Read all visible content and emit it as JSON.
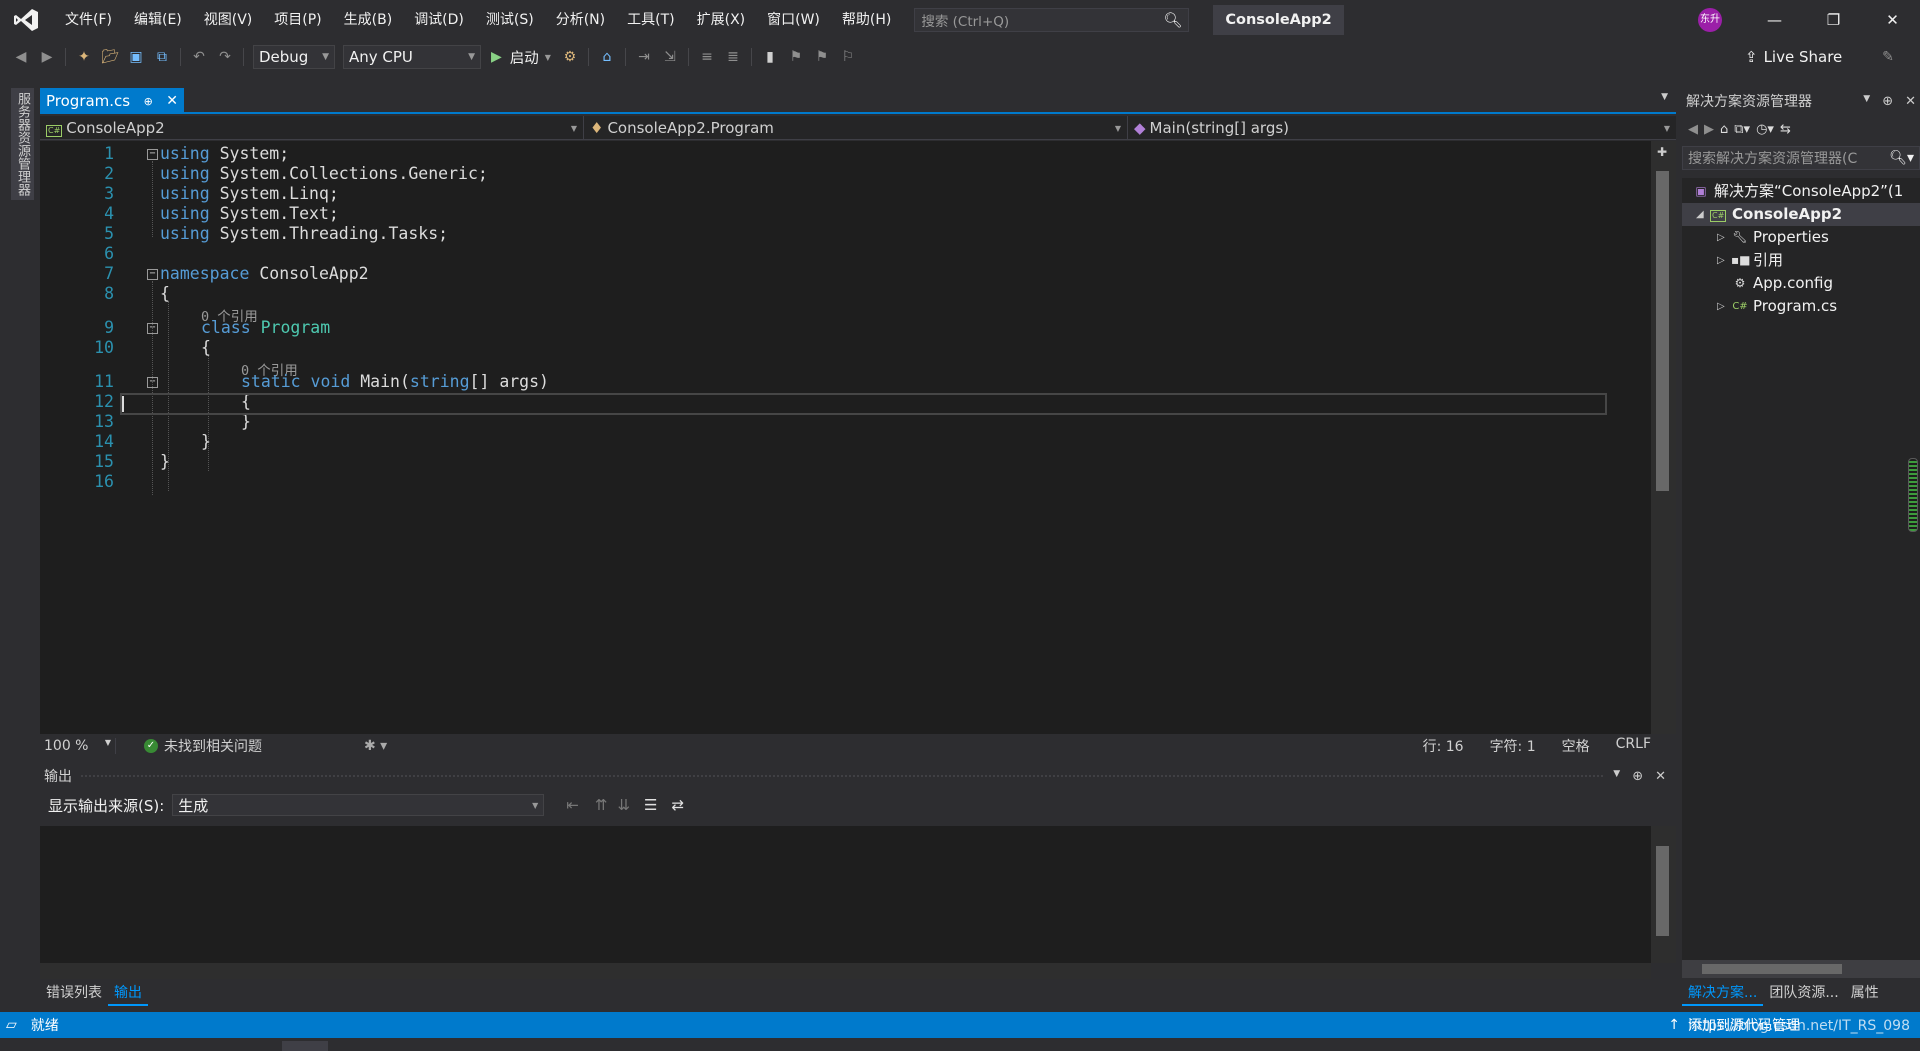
{
  "menu": [
    "文件(F)",
    "编辑(E)",
    "视图(V)",
    "项目(P)",
    "生成(B)",
    "调试(D)",
    "测试(S)",
    "分析(N)",
    "工具(T)",
    "扩展(X)",
    "窗口(W)",
    "帮助(H)"
  ],
  "search": {
    "placeholder": "搜索 (Ctrl+Q)"
  },
  "title": "ConsoleApp2",
  "avatar": "东升",
  "toolbar": {
    "config": "Debug",
    "platform": "Any CPU",
    "run_label": "启动",
    "live_share": "Live Share"
  },
  "server_explorer": "服务器资源管理器",
  "editor": {
    "tab": "Program.cs",
    "nav_project": "ConsoleApp2",
    "nav_class": "ConsoleApp2.Program",
    "nav_member": "Main(string[] args)",
    "code_lens": "0 个引用",
    "line_numbers": [
      "1",
      "2",
      "3",
      "4",
      "5",
      "6",
      "7",
      "8",
      "9",
      "10",
      "11",
      "12",
      "13",
      "14",
      "15",
      "16"
    ],
    "code": {
      "l1_kw": "using",
      "l1_rest": " System;",
      "l2_kw": "using",
      "l2_rest": " System.Collections.Generic;",
      "l3_kw": "using",
      "l3_rest": " System.Linq;",
      "l4_kw": "using",
      "l4_rest": " System.Text;",
      "l5_kw": "using",
      "l5_rest": " System.Threading.Tasks;",
      "l7_kw": "namespace",
      "l7_rest": " ConsoleApp2",
      "open": "{",
      "close": "}",
      "l9_kw": "class",
      "l9_type": "Program",
      "l11_kw1": "static",
      "l11_kw2": "void",
      "l11_name": "Main(",
      "l11_kw3": "string",
      "l11_rest": "[] args)"
    }
  },
  "editor_status": {
    "zoom": "100 %",
    "issues": "未找到相关问题",
    "line": "行: 16",
    "char": "字符: 1",
    "space": "空格",
    "eol": "CRLF"
  },
  "output": {
    "title": "输出",
    "source_label": "显示输出来源(S):",
    "source_value": "生成"
  },
  "bottom_tabs": [
    "错误列表",
    "输出"
  ],
  "solution_explorer": {
    "title": "解决方案资源管理器",
    "search_placeholder": "搜索解决方案资源管理器(C",
    "solution": "解决方案“ConsoleApp2”(1",
    "project": "ConsoleApp2",
    "items": [
      "Properties",
      "引用",
      "App.config",
      "Program.cs"
    ],
    "tabs": [
      "解决方案...",
      "团队资源...",
      "属性"
    ]
  },
  "statusbar": {
    "ready": "就绪",
    "add_source": "添加到源代码管理",
    "watermark": "https://blog.csdn.net/IT_RS_098"
  }
}
